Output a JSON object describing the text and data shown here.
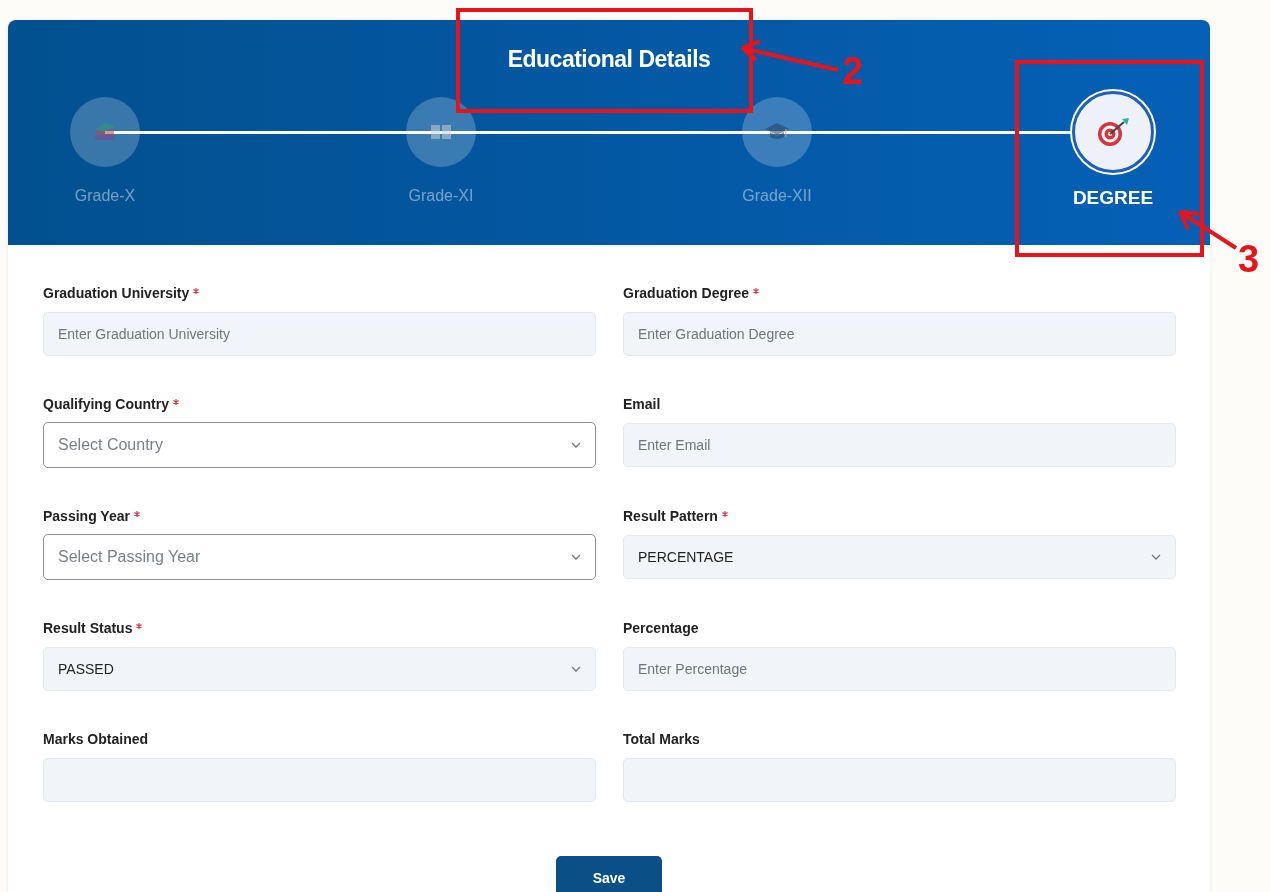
{
  "header": {
    "title": "Educational Details"
  },
  "steps": [
    {
      "label": "Grade-X",
      "kind": "books",
      "selected": false
    },
    {
      "label": "Grade-XI",
      "kind": "book",
      "selected": false
    },
    {
      "label": "Grade-XII",
      "kind": "cap",
      "selected": false
    },
    {
      "label": "DEGREE",
      "kind": "target",
      "selected": true
    }
  ],
  "fields": [
    {
      "label": "Graduation University",
      "required": true,
      "kind": "text",
      "placeholder": "Enter Graduation University"
    },
    {
      "label": "Graduation Degree",
      "required": true,
      "kind": "text",
      "placeholder": "Enter Graduation Degree"
    },
    {
      "label": "Qualifying Country",
      "required": true,
      "kind": "select",
      "placeholder": "Select Country"
    },
    {
      "label": "Email",
      "required": false,
      "kind": "text",
      "placeholder": "Enter Email"
    },
    {
      "label": "Passing Year",
      "required": true,
      "kind": "select",
      "placeholder": "Select Passing Year"
    },
    {
      "label": "Result Pattern",
      "required": true,
      "kind": "select",
      "value": "PERCENTAGE"
    },
    {
      "label": "Result Status",
      "required": true,
      "kind": "select",
      "value": "PASSED"
    },
    {
      "label": "Percentage",
      "required": false,
      "kind": "text",
      "placeholder": "Enter Percentage"
    },
    {
      "label": "Marks Obtained",
      "required": false,
      "kind": "text"
    },
    {
      "label": "Total Marks",
      "required": false,
      "kind": "text"
    }
  ],
  "save_button": "Save",
  "callouts": [
    {
      "label": "2"
    },
    {
      "label": "3"
    }
  ]
}
